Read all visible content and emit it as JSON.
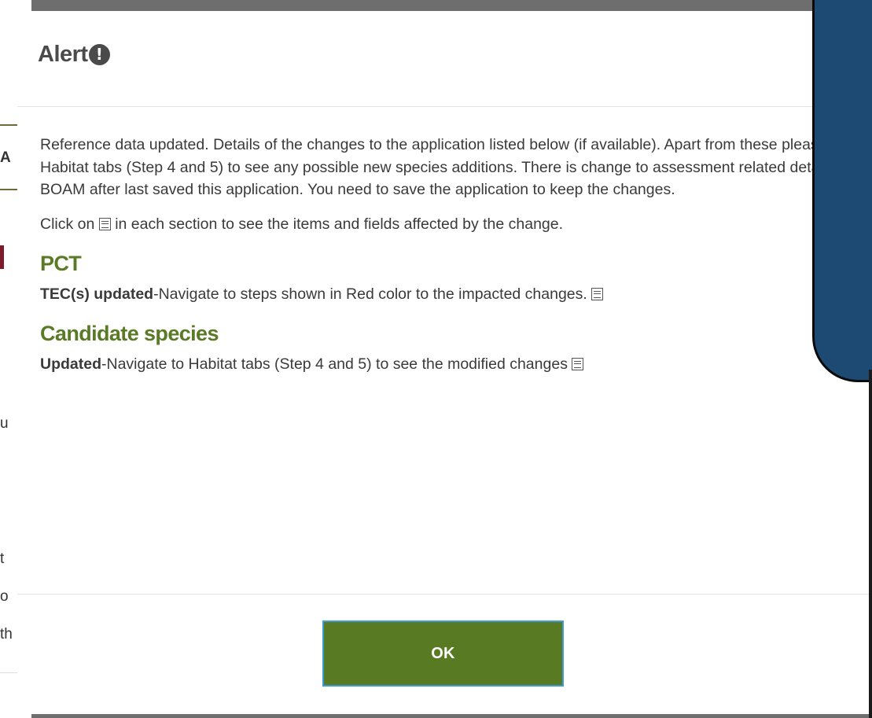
{
  "background": {
    "fragments": [
      "A",
      "I",
      "u",
      "t",
      "o",
      "th"
    ]
  },
  "modal": {
    "title": "Alert",
    "title_icon": "exclamation-circle-icon",
    "intro": "Reference data updated. Details of the changes to the application listed below (if available). Apart from these please visit Habitat tabs (Step 4 and 5) to see any possible new species additions. There is change to assessment related details in BOAM after last saved this application. You need to save the application to keep the changes.",
    "click_prefix": "Click on",
    "click_suffix": "in each section to see the items and fields affected by the change.",
    "sections": [
      {
        "heading": "PCT",
        "bold": "TEC(s) updated",
        "text": "-Navigate to steps shown in Red color to the impacted changes."
      },
      {
        "heading": "Candidate species",
        "bold": "Updated",
        "text": "-Navigate to Habitat tabs (Step 4 and 5) to see the modified changes"
      }
    ],
    "ok_label": "OK"
  },
  "colors": {
    "heading_green": "#5b7a26",
    "button_green": "#587a23",
    "overlay_blue": "#1c4a73"
  }
}
